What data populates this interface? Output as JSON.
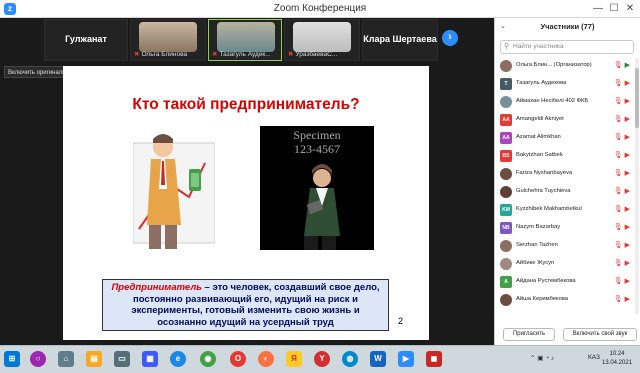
{
  "window": {
    "title": "Zoom Конференция"
  },
  "video_strip": {
    "tiles": [
      {
        "name": "Гулжанат",
        "type": "name"
      },
      {
        "name": "Ольга Блинова",
        "type": "video"
      },
      {
        "name": "Тазагуль Аудек...",
        "type": "video"
      },
      {
        "name": "УразбаеваС...",
        "type": "video"
      },
      {
        "name": "Клара Шертаева",
        "type": "name"
      }
    ],
    "next_label": "›"
  },
  "audio_button": {
    "label": "Включить оригинальный звук",
    "arrow": "▾"
  },
  "slide": {
    "title": "Кто такой предприниматель?",
    "image_text": "Specimen\n123-4567",
    "definition_keyword": "Предприниматель",
    "definition_rest": " – это человек, создавший свое дело, постоянно развивающий его, идущий на риск и эксперименты, готовый изменить свою жизнь и осознанно идущий на усердный труд",
    "page_number": "2"
  },
  "participants": {
    "header": "Участники (77)",
    "search_placeholder": "Найти участника",
    "items": [
      {
        "name": "Ольга Блин... (Организатор)",
        "avatar": "",
        "color": "#8d6e63",
        "photo": true,
        "cam": "on",
        "mic": "off"
      },
      {
        "name": "Тазагуль Аудекова",
        "avatar": "T",
        "color": "#455a64",
        "photo": false,
        "cam": "off",
        "mic": "off"
      },
      {
        "name": "Аймахан Несібелі 402  ФКБ",
        "avatar": "",
        "color": "#78909c",
        "photo": true,
        "cam": "off",
        "mic": "off"
      },
      {
        "name": "Amangeldi Akniyet",
        "avatar": "AA",
        "color": "#e53935",
        "photo": false,
        "cam": "off",
        "mic": "off"
      },
      {
        "name": "Azamat Alimkhan",
        "avatar": "AA",
        "color": "#ab47bc",
        "photo": false,
        "cam": "off",
        "mic": "off"
      },
      {
        "name": "Bakytzhan Satbek",
        "avatar": "BS",
        "color": "#e53935",
        "photo": false,
        "cam": "off",
        "mic": "off"
      },
      {
        "name": "Fariza Nyshanbayeva",
        "avatar": "",
        "color": "#6d4c41",
        "photo": true,
        "cam": "off",
        "mic": "off"
      },
      {
        "name": "Gulchehra Tuychieva",
        "avatar": "",
        "color": "#5d4037",
        "photo": true,
        "cam": "off",
        "mic": "off"
      },
      {
        "name": "Kyzzhibek Makhambetkul",
        "avatar": "KM",
        "color": "#26a69a",
        "photo": false,
        "cam": "off",
        "mic": "off"
      },
      {
        "name": "Nazym Bazarbay",
        "avatar": "NB",
        "color": "#7e57c2",
        "photo": false,
        "cam": "off",
        "mic": "off"
      },
      {
        "name": "Serzhan Tazhen",
        "avatar": "",
        "color": "#8d6e63",
        "photo": true,
        "cam": "off",
        "mic": "off"
      },
      {
        "name": "Айбике Жусуп",
        "avatar": "",
        "color": "#a1887f",
        "photo": true,
        "cam": "off",
        "mic": "off"
      },
      {
        "name": "Айдана Рустембекова",
        "avatar": "А",
        "color": "#43a047",
        "photo": false,
        "cam": "off",
        "mic": "off"
      },
      {
        "name": "Айша Керимбекова",
        "avatar": "",
        "color": "#6d4c41",
        "photo": true,
        "cam": "off",
        "mic": "off"
      }
    ],
    "invite_label": "Пригласить",
    "unmute_label": "Включить свой звук"
  },
  "taskbar": {
    "lang": "КАЗ",
    "time": "10:24",
    "date": "13.04.2021"
  }
}
